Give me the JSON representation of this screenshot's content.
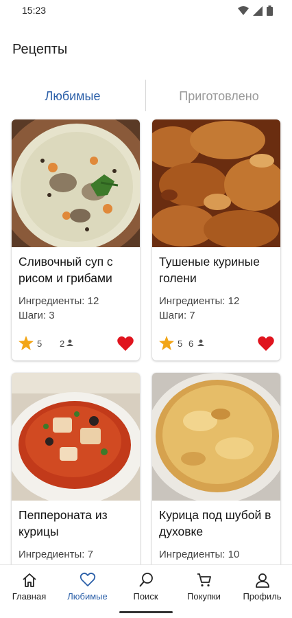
{
  "status": {
    "time": "15:23"
  },
  "header": {
    "title": "Рецепты"
  },
  "tabs": [
    {
      "label": "Любимые",
      "active": true
    },
    {
      "label": "Приготовлено",
      "active": false
    }
  ],
  "recipes": [
    {
      "title": "Сливочный суп с рисом и грибами",
      "ingredients": "Ингредиенты: 12",
      "steps": "Шаги: 3",
      "rating": "5",
      "cooks": "2",
      "favorite": true,
      "image": "creamy-mushroom-rice-soup"
    },
    {
      "title": "Тушеные куриные голени",
      "ingredients": "Ингредиенты: 12",
      "steps": "Шаги: 7",
      "rating": "5",
      "cooks": "6",
      "favorite": true,
      "image": "braised-chicken-drumsticks"
    },
    {
      "title": "Пеппероната из курицы",
      "ingredients": "Ингредиенты: 7",
      "steps": "",
      "rating": "",
      "cooks": "",
      "favorite": true,
      "image": "chicken-peperonata-bowl"
    },
    {
      "title": "Курица под шубой в духовке",
      "ingredients": "Ингредиенты: 10",
      "steps": "",
      "rating": "",
      "cooks": "",
      "favorite": true,
      "image": "baked-chicken-casserole"
    }
  ],
  "bottom_nav": [
    {
      "label": "Главная",
      "icon": "home-icon"
    },
    {
      "label": "Любимые",
      "icon": "heart-icon",
      "active": true
    },
    {
      "label": "Поиск",
      "icon": "search-icon"
    },
    {
      "label": "Покупки",
      "icon": "cart-icon"
    },
    {
      "label": "Профиль",
      "icon": "profile-icon"
    }
  ],
  "colors": {
    "accent": "#2b5fa8",
    "heart": "#e0141e",
    "star": "#f2a516",
    "inactive_tab": "#9a9a9a"
  }
}
